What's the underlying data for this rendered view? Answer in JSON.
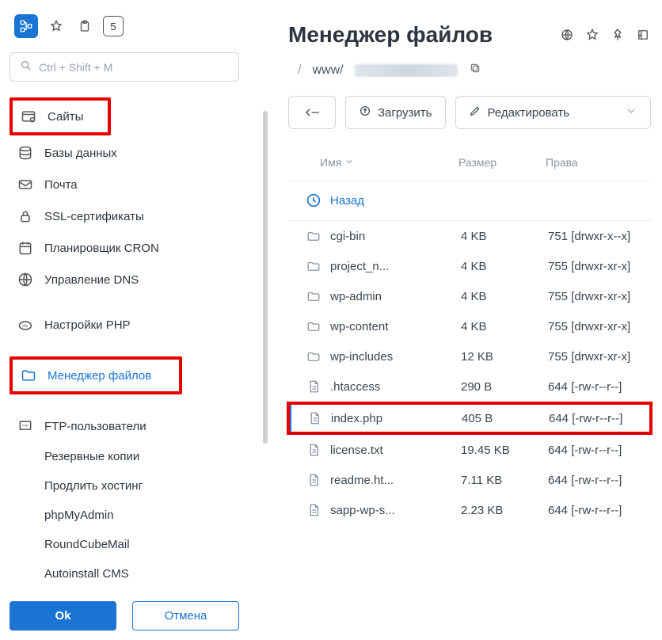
{
  "top": {
    "box_digit": "5"
  },
  "search": {
    "placeholder": "Ctrl + Shift + M"
  },
  "nav": {
    "sites": "Сайты",
    "databases": "Базы данных",
    "mail": "Почта",
    "ssl": "SSL-сертификаты",
    "cron": "Планировщик CRON",
    "dns": "Управление DNS",
    "php": "Настройки PHP",
    "filemanager": "Менеджер файлов",
    "ftp": "FTP-пользователи",
    "backups": "Резервные копии",
    "renew": "Продлить хостинг",
    "phpmyadmin": "phpMyAdmin",
    "roundcube": "RoundCubeMail",
    "autoinstall": "Autoinstall CMS"
  },
  "buttons": {
    "ok": "Ok",
    "cancel": "Отмена"
  },
  "main": {
    "title": "Менеджер файлов"
  },
  "breadcrumb": {
    "root": "/",
    "www": "www/"
  },
  "toolbar": {
    "upload": "Загрузить",
    "edit": "Редактировать"
  },
  "table": {
    "name": "Имя",
    "size": "Размер",
    "perm": "Права",
    "back": "Назад"
  },
  "files": [
    {
      "type": "folder",
      "name": "cgi-bin",
      "size": "4 KB",
      "perm": "751 [drwxr-x--x]"
    },
    {
      "type": "folder",
      "name": "project_n...",
      "size": "4 KB",
      "perm": "755 [drwxr-xr-x]"
    },
    {
      "type": "folder",
      "name": "wp-admin",
      "size": "4 KB",
      "perm": "755 [drwxr-xr-x]"
    },
    {
      "type": "folder",
      "name": "wp-content",
      "size": "4 KB",
      "perm": "755 [drwxr-xr-x]"
    },
    {
      "type": "folder",
      "name": "wp-includes",
      "size": "12 KB",
      "perm": "755 [drwxr-xr-x]"
    },
    {
      "type": "file",
      "name": ".htaccess",
      "size": "290 B",
      "perm": "644 [-rw-r--r--]"
    },
    {
      "type": "file",
      "name": "index.php",
      "size": "405 B",
      "perm": "644 [-rw-r--r--]",
      "highlight": true
    },
    {
      "type": "file",
      "name": "license.txt",
      "size": "19.45 KB",
      "perm": "644 [-rw-r--r--]"
    },
    {
      "type": "file",
      "name": "readme.ht...",
      "size": "7.11 KB",
      "perm": "644 [-rw-r--r--]"
    },
    {
      "type": "file",
      "name": "sapp-wp-s...",
      "size": "2.23 KB",
      "perm": "644 [-rw-r--r--]"
    }
  ]
}
